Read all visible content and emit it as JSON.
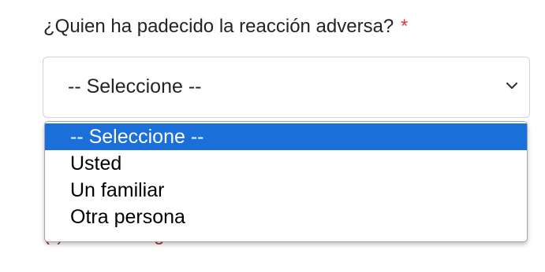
{
  "question": {
    "label": "¿Quien ha padecido la reacción adversa?",
    "required_marker": "*"
  },
  "select": {
    "value": "-- Seleccione --",
    "chevron_icon": "chevron-down-icon"
  },
  "dropdown": {
    "options": [
      {
        "label": "-- Seleccione --",
        "selected": true
      },
      {
        "label": "Usted",
        "selected": false
      },
      {
        "label": "Un familiar",
        "selected": false
      },
      {
        "label": "Otra persona",
        "selected": false
      }
    ]
  },
  "hint": {
    "text": "(*) Indica obligatoriedad/a condicional."
  },
  "colors": {
    "selected_option_bg": "#1a6fd9",
    "required_red": "#dc3545",
    "text": "#212529"
  }
}
